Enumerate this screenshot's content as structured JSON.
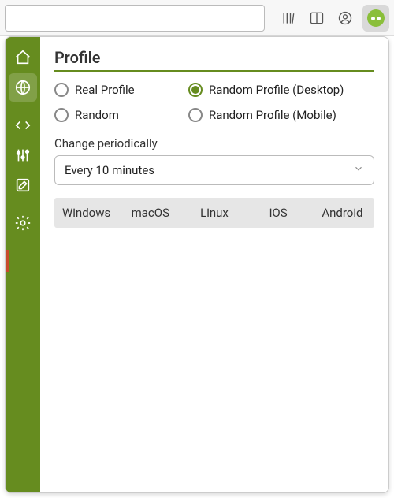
{
  "topbar": {
    "url_value": "",
    "icons": [
      "library",
      "reader",
      "account"
    ]
  },
  "sidebar": {
    "items": [
      {
        "id": "home"
      },
      {
        "id": "globe"
      },
      {
        "id": "code"
      },
      {
        "id": "sliders"
      },
      {
        "id": "edit"
      },
      {
        "id": "settings"
      }
    ],
    "active_index": 1
  },
  "section": {
    "title": "Profile",
    "options": [
      {
        "label": "Real Profile",
        "selected": false
      },
      {
        "label": "Random Profile (Desktop)",
        "selected": true
      },
      {
        "label": "Random",
        "selected": false
      },
      {
        "label": "Random Profile (Mobile)",
        "selected": false
      }
    ],
    "periodic_label": "Change periodically",
    "periodic_value": "Every 10 minutes",
    "os_tabs": [
      "Windows",
      "macOS",
      "Linux",
      "iOS",
      "Android"
    ]
  }
}
